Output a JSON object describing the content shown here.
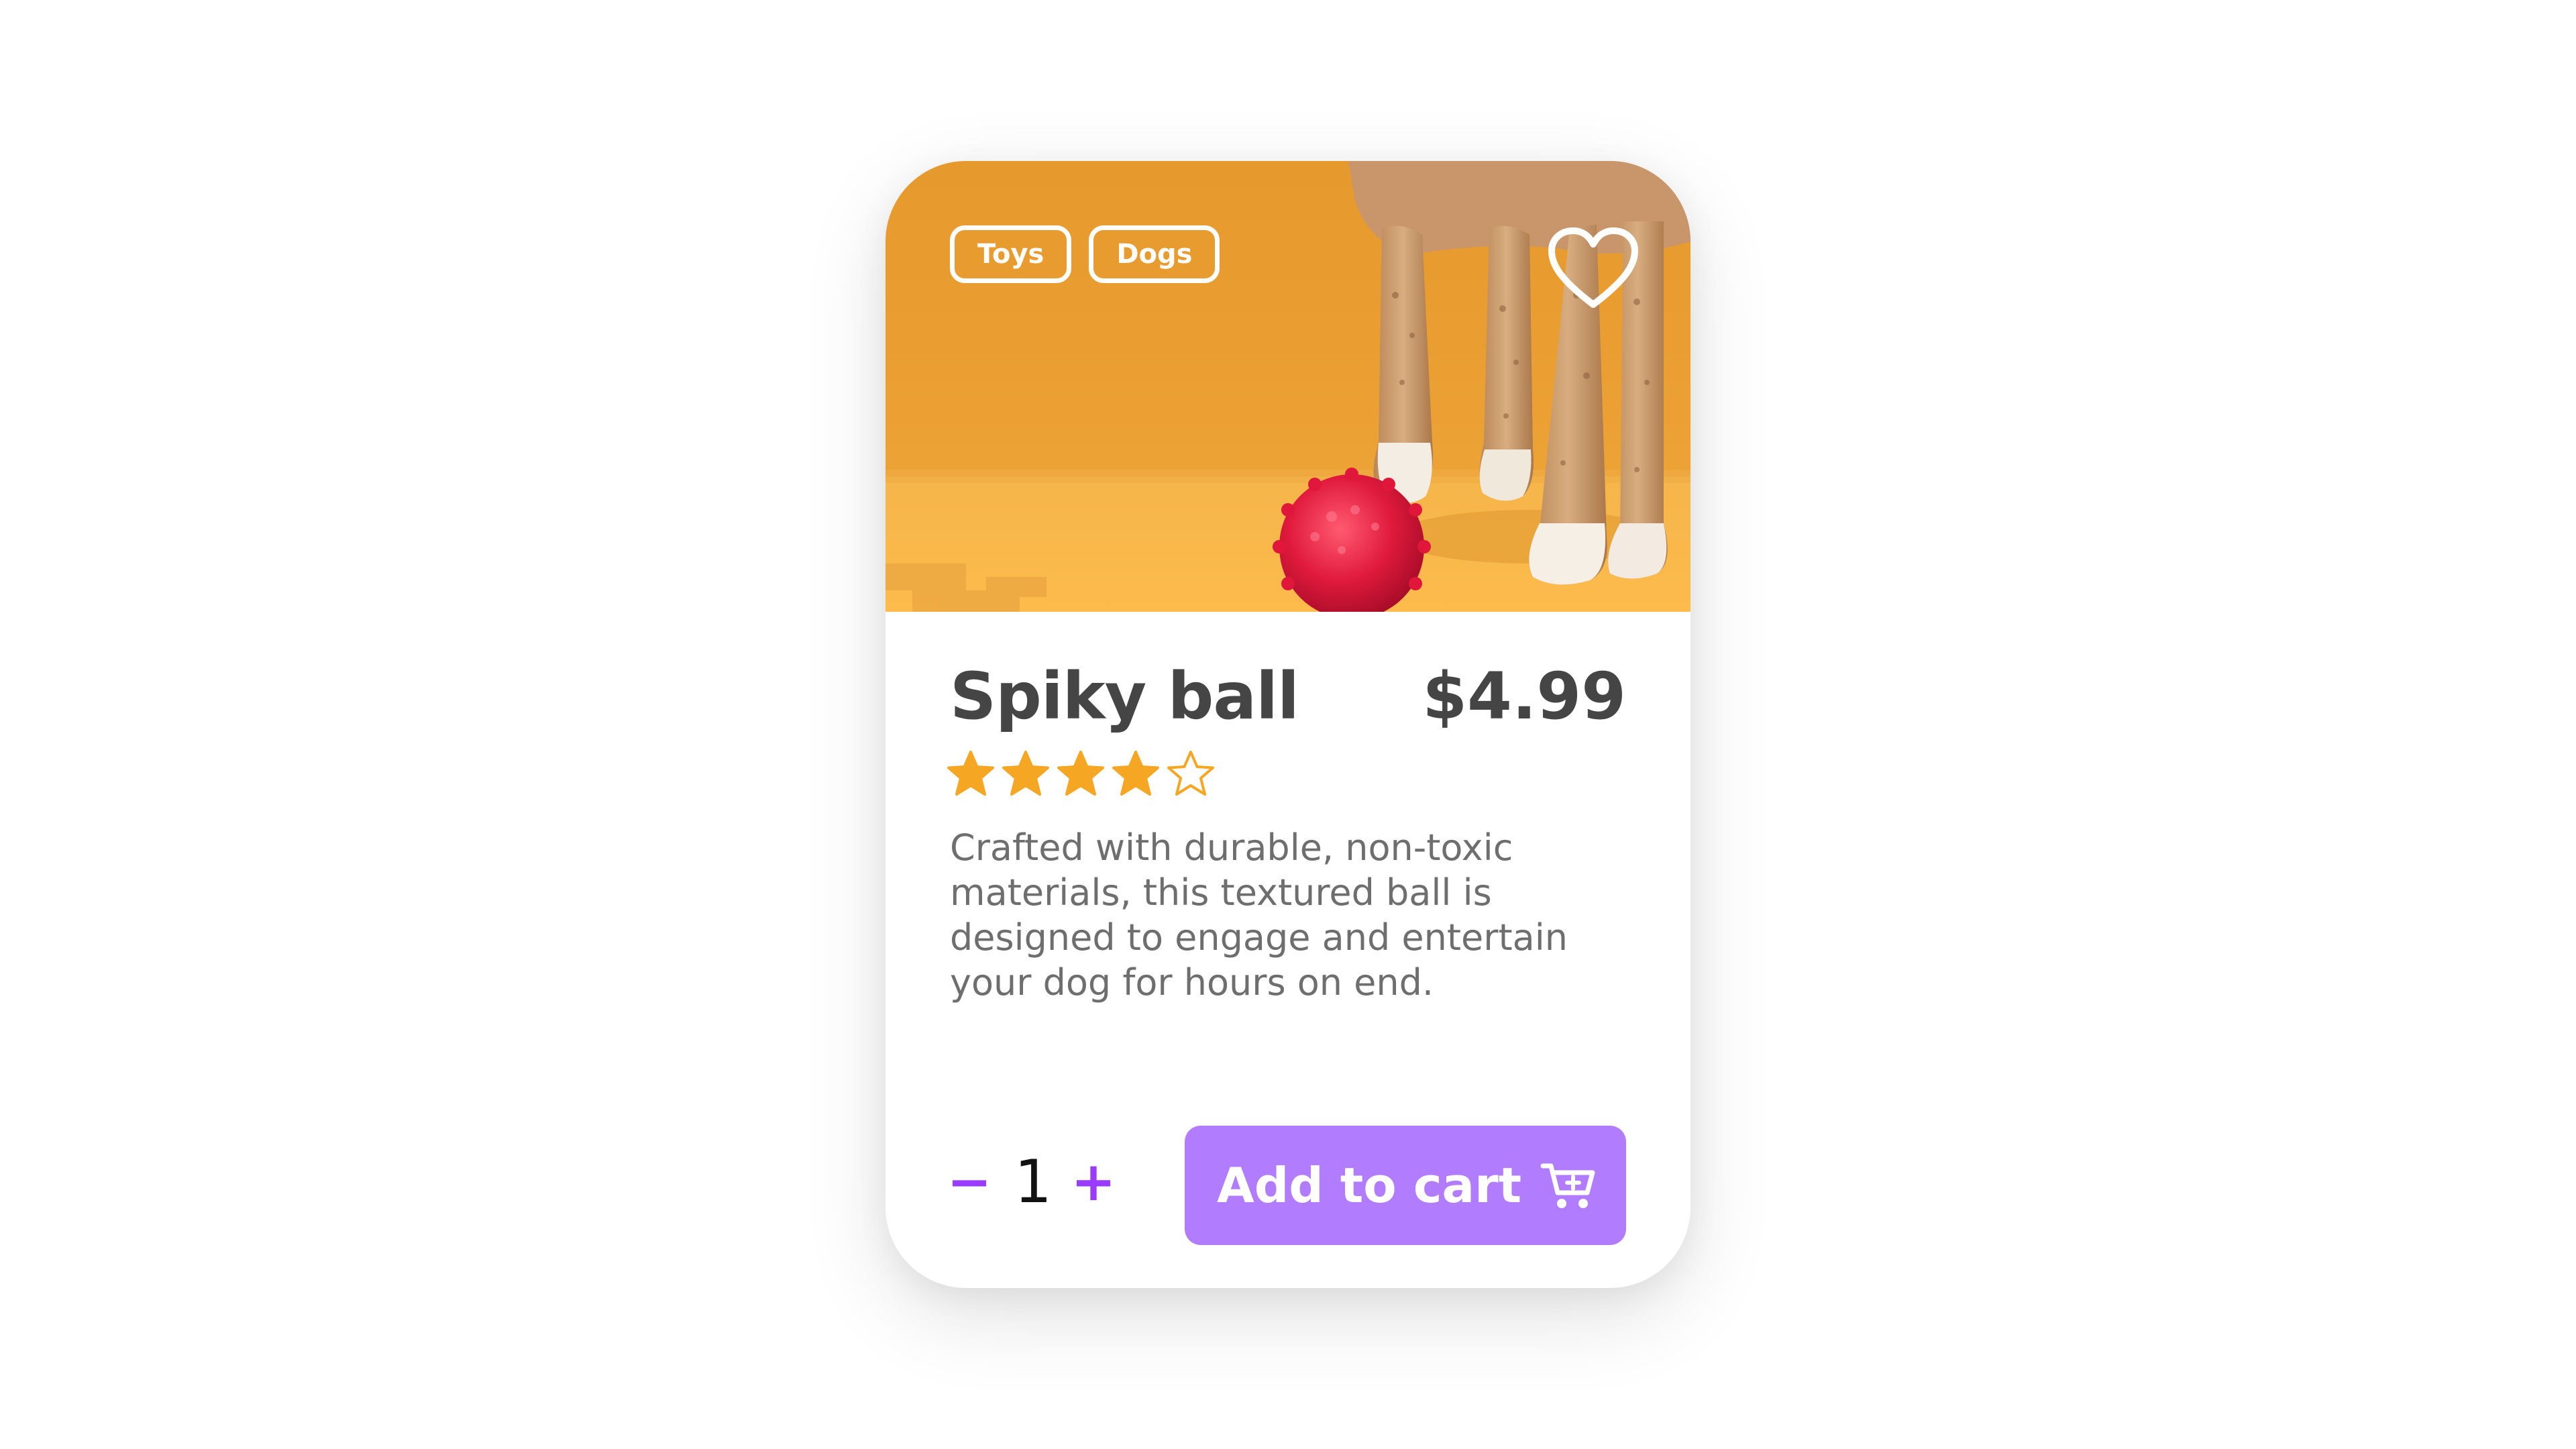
{
  "product": {
    "tags": [
      "Toys",
      "Dogs"
    ],
    "name": "Spiky ball",
    "price": "$4.99",
    "rating": 4,
    "rating_max": 5,
    "description": "Crafted with durable, non-toxic materials, this textured ball is designed to engage and entertain your dog for hours on end."
  },
  "quantity": {
    "decrement": "−",
    "value": "1",
    "increment": "+"
  },
  "cart_button": {
    "label": "Add to cart",
    "icon": "cart-plus-icon"
  },
  "favorite": {
    "icon": "heart-outline-icon"
  },
  "colors": {
    "hero_background": "#e89c2e",
    "accent_purple": "#b27cff",
    "quantity_purple": "#9a3cff",
    "star": "#f5a623",
    "title_text": "#454545",
    "body_text": "#6e6e6e"
  }
}
